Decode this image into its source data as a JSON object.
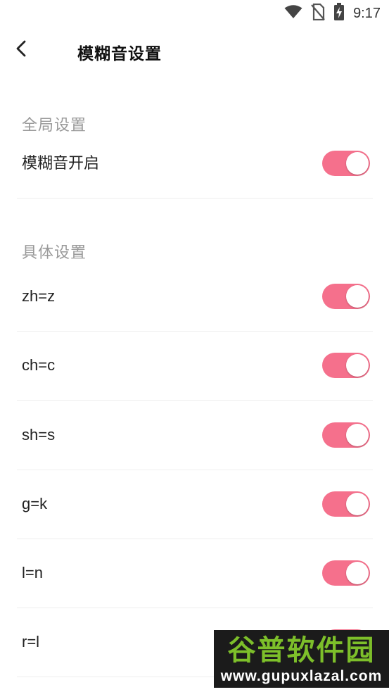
{
  "status_bar": {
    "time": "9:17",
    "icons": [
      "wifi-icon",
      "no-sim-icon",
      "battery-charging-icon"
    ]
  },
  "header": {
    "back_icon": "chevron-left-icon",
    "title": "模糊音设置"
  },
  "global_section": {
    "title": "全局设置",
    "items": [
      {
        "label": "模糊音开启",
        "enabled": true
      }
    ]
  },
  "detail_section": {
    "title": "具体设置",
    "items": [
      {
        "label": "zh=z",
        "enabled": true
      },
      {
        "label": "ch=c",
        "enabled": true
      },
      {
        "label": "sh=s",
        "enabled": true
      },
      {
        "label": "g=k",
        "enabled": true
      },
      {
        "label": "l=n",
        "enabled": true
      },
      {
        "label": "r=l",
        "enabled": true
      }
    ]
  },
  "colors": {
    "toggle_on": "#f5708c",
    "section_title": "#9a9a9a",
    "divider": "#eeeeee"
  },
  "watermark": {
    "chinese": "谷普软件园",
    "url": "www.gupuxlazal.com"
  }
}
